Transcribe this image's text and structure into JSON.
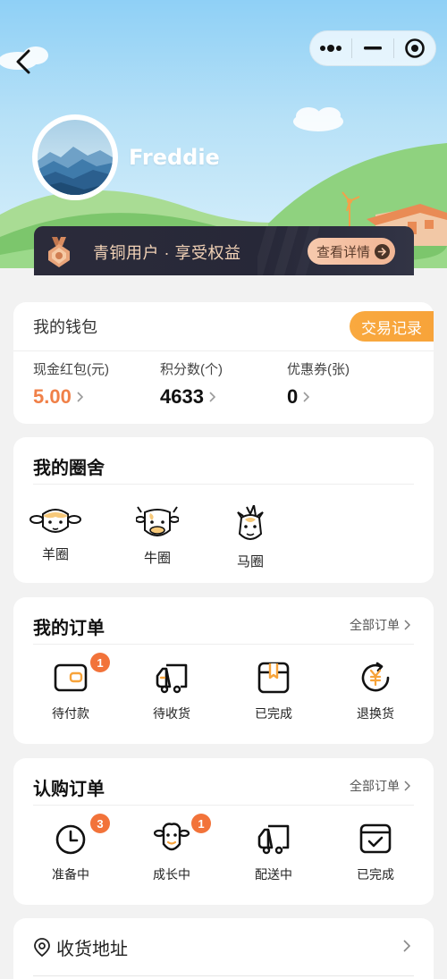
{
  "header": {
    "username": "Freddie"
  },
  "member": {
    "text": "青铜用户 · 享受权益",
    "detail_label": "查看详情"
  },
  "wallet": {
    "title": "我的钱包",
    "trade_label": "交易记录",
    "stats": [
      {
        "label": "现金红包(元)",
        "value": "5.00"
      },
      {
        "label": "积分数(个)",
        "value": "4633"
      },
      {
        "label": "优惠券(张)",
        "value": "0"
      }
    ]
  },
  "pens": {
    "title": "我的圈舍",
    "items": [
      {
        "label": "羊圈",
        "icon": "sheep-icon"
      },
      {
        "label": "牛圈",
        "icon": "cow-icon"
      },
      {
        "label": "马圈",
        "icon": "horse-icon"
      }
    ]
  },
  "orders": {
    "title": "我的订单",
    "all_label": "全部订单",
    "items": [
      {
        "label": "待付款",
        "icon": "wallet-icon",
        "badge": "1"
      },
      {
        "label": "待收货",
        "icon": "truck-icon"
      },
      {
        "label": "已完成",
        "icon": "box-icon"
      },
      {
        "label": "退换货",
        "icon": "yen-refresh-icon"
      }
    ]
  },
  "subscription": {
    "title": "认购订单",
    "all_label": "全部订单",
    "items": [
      {
        "label": "准备中",
        "icon": "clock-icon",
        "badge": "3"
      },
      {
        "label": "成长中",
        "icon": "sheep-face-icon",
        "badge": "1"
      },
      {
        "label": "配送中",
        "icon": "truck-icon"
      },
      {
        "label": "已完成",
        "icon": "checked-box-icon"
      }
    ]
  },
  "address": {
    "label": "收货地址"
  },
  "colors": {
    "accent_orange": "#f7a33a",
    "badge_red": "#f2733a",
    "member_gold": "#f3d3b7"
  }
}
